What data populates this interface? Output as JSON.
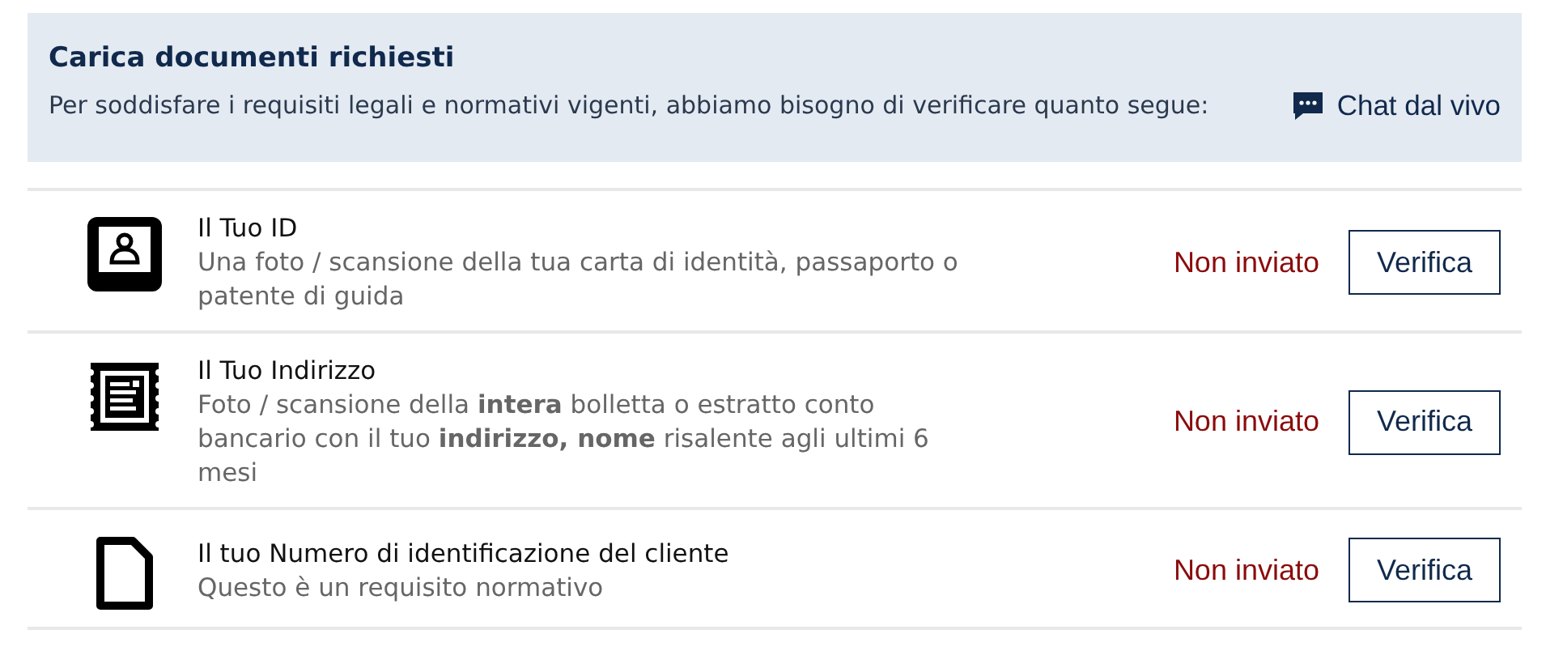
{
  "header": {
    "title": "Carica documenti richiesti",
    "text": "Per soddisfare i requisiti legali e normativi vigenti, abbiamo bisogno di verificare quanto segue:",
    "chat_link": "Chat dal vivo"
  },
  "documents": [
    {
      "kind": "id",
      "title": "Il Tuo ID",
      "description": "Una foto / scansione della tua carta di identità, passaporto o patente di guida",
      "status": "Non inviato",
      "button": "Verifica"
    },
    {
      "kind": "address",
      "title": "Il Tuo Indirizzo",
      "description": "Foto / scansione della **intera** bolletta o estratto conto bancario con il tuo **indirizzo, nome** risalente agli ultimi 6 mesi",
      "status": "Non inviato",
      "button": "Verifica"
    },
    {
      "kind": "document",
      "title": "Il tuo Numero di identificazione del cliente",
      "description": "Questo è un requisito normativo",
      "status": "Non inviato",
      "button": "Verifica"
    }
  ]
}
